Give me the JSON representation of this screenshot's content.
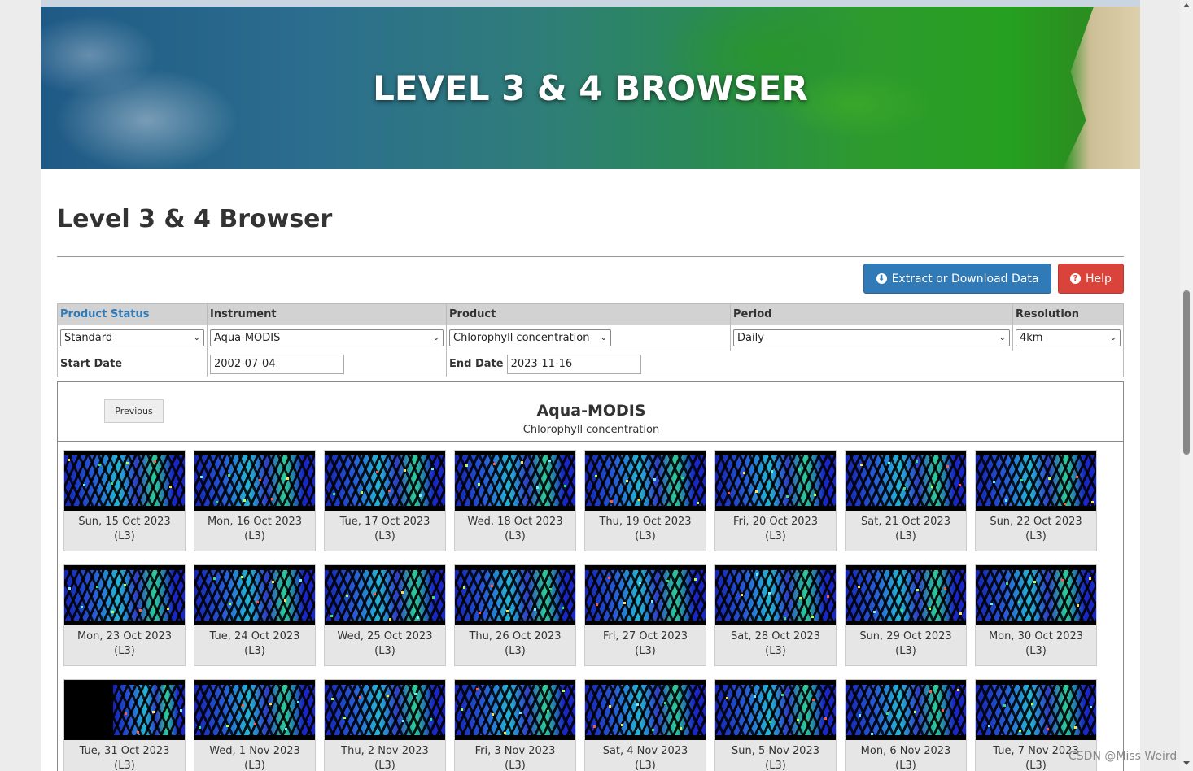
{
  "banner": {
    "title": "LEVEL 3 & 4 BROWSER"
  },
  "page_title": "Level 3 & 4 Browser",
  "buttons": {
    "extract": "Extract or Download Data",
    "help": "Help"
  },
  "controls": {
    "headers": [
      "Product Status",
      "Instrument",
      "Product",
      "Period",
      "Resolution"
    ],
    "selects": {
      "status": "Standard",
      "instrument": "Aqua-MODIS",
      "product": "Chlorophyll concentration",
      "period": "Daily",
      "resolution": "4km"
    },
    "start_label": "Start Date",
    "start_value": "2002-07-04",
    "end_label": "End Date",
    "end_value": "2023-11-16"
  },
  "viewer": {
    "previous": "Previous",
    "title": "Aqua-MODIS",
    "subtitle": "Chlorophyll concentration",
    "tiles": [
      {
        "date": "Sun, 15 Oct 2023",
        "level": "(L3)"
      },
      {
        "date": "Mon, 16 Oct 2023",
        "level": "(L3)"
      },
      {
        "date": "Tue, 17 Oct 2023",
        "level": "(L3)"
      },
      {
        "date": "Wed, 18 Oct 2023",
        "level": "(L3)"
      },
      {
        "date": "Thu, 19 Oct 2023",
        "level": "(L3)"
      },
      {
        "date": "Fri, 20 Oct 2023",
        "level": "(L3)"
      },
      {
        "date": "Sat, 21 Oct 2023",
        "level": "(L3)"
      },
      {
        "date": "Sun, 22 Oct 2023",
        "level": "(L3)"
      },
      {
        "date": "Mon, 23 Oct 2023",
        "level": "(L3)"
      },
      {
        "date": "Tue, 24 Oct 2023",
        "level": "(L3)"
      },
      {
        "date": "Wed, 25 Oct 2023",
        "level": "(L3)"
      },
      {
        "date": "Thu, 26 Oct 2023",
        "level": "(L3)"
      },
      {
        "date": "Fri, 27 Oct 2023",
        "level": "(L3)"
      },
      {
        "date": "Sat, 28 Oct 2023",
        "level": "(L3)"
      },
      {
        "date": "Sun, 29 Oct 2023",
        "level": "(L3)"
      },
      {
        "date": "Mon, 30 Oct 2023",
        "level": "(L3)"
      },
      {
        "date": "Tue, 31 Oct 2023",
        "level": "(L3)"
      },
      {
        "date": "Wed, 1 Nov 2023",
        "level": "(L3)"
      },
      {
        "date": "Thu, 2 Nov 2023",
        "level": "(L3)"
      },
      {
        "date": "Fri, 3 Nov 2023",
        "level": "(L3)"
      },
      {
        "date": "Sat, 4 Nov 2023",
        "level": "(L3)"
      },
      {
        "date": "Sun, 5 Nov 2023",
        "level": "(L3)"
      },
      {
        "date": "Mon, 6 Nov 2023",
        "level": "(L3)"
      },
      {
        "date": "Tue, 7 Nov 2023",
        "level": "(L3)"
      }
    ]
  },
  "watermark": "CSDN @Miss Weird",
  "colors": {
    "primary": "#2f7ab7",
    "danger": "#d9433a",
    "header_bg": "#d2d2d2"
  }
}
